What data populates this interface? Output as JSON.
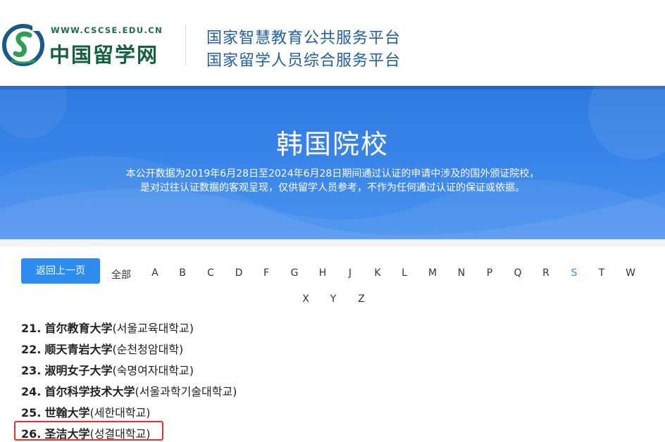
{
  "header": {
    "logo_url_text": "WWW.CSCSE.EDU.CN",
    "logo_name": "中国留学网",
    "platform_line1": "国家智慧教育公共服务平台",
    "platform_line2": "国家留学人员综合服务平台",
    "brand_color": "#15603f",
    "platform_color": "#1f5faa"
  },
  "banner": {
    "title": "韩国院校",
    "desc_line1": "本公开数据为2019年6月28日至2024年6月28日期间通过认证的申请中涉及的国外颁证院校，",
    "desc_line2": "是对过往认证数据的客观呈现，仅供留学人员参考，不作为任何通过认证的保证或依据。",
    "bg_color": "#3a86ea"
  },
  "nav": {
    "back_label": "返回上一页",
    "all_label": "全部",
    "letters": [
      "A",
      "B",
      "C",
      "D",
      "F",
      "G",
      "H",
      "J",
      "K",
      "L",
      "M",
      "N",
      "P",
      "Q",
      "R",
      "S",
      "T",
      "W",
      "X",
      "Y",
      "Z"
    ],
    "active_letter": "S",
    "accent_color": "#2d8cf0"
  },
  "schools": [
    {
      "num": "21.",
      "cn": "首尔教育大学",
      "kr": "(서울교육대학교)"
    },
    {
      "num": "22.",
      "cn": "顺天青岩大学",
      "kr": "(순천청암대학)"
    },
    {
      "num": "23.",
      "cn": "淑明女子大学",
      "kr": "(숙명여자대학교)"
    },
    {
      "num": "24.",
      "cn": "首尔科学技术大学",
      "kr": "(서울과학기술대학교)"
    },
    {
      "num": "25.",
      "cn": "世翰大学",
      "kr": "(세한대학교)"
    },
    {
      "num": "26.",
      "cn": "圣洁大学",
      "kr": "(성결대학교)"
    }
  ],
  "highlight_color": "#e5302a"
}
